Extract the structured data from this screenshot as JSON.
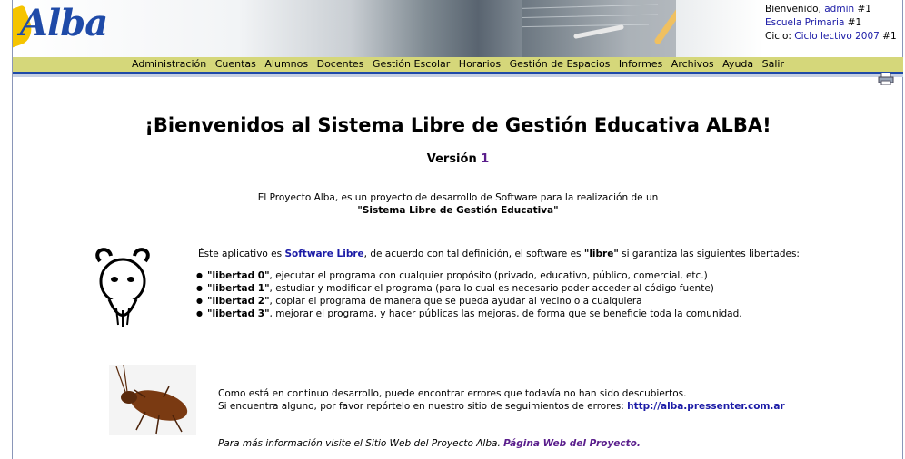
{
  "user": {
    "welcome_prefix": "Bienvenido, ",
    "username": "admin",
    "username_suffix": " #1",
    "school": "Escuela Primaria",
    "school_suffix": " #1",
    "cycle_prefix": "Ciclo: ",
    "cycle": "Ciclo lectivo 2007",
    "cycle_suffix": " #1"
  },
  "logo": {
    "text": "Alba"
  },
  "menu": [
    "Administración",
    "Cuentas",
    "Alumnos",
    "Docentes",
    "Gestión Escolar",
    "Horarios",
    "Gestión de Espacios",
    "Informes",
    "Archivos",
    "Ayuda",
    "Salir"
  ],
  "main": {
    "title": "¡Bienvenidos al Sistema Libre de Gestión Educativa ALBA!",
    "version_label": "Versión ",
    "version_number": "1",
    "intro_line1": "El Proyecto Alba, es un proyecto de desarrollo de Software para la realización de un",
    "intro_line2": "\"Sistema Libre de Gestión Educativa\"",
    "free_prefix": "Éste aplicativo es ",
    "free_link": "Software Libre",
    "free_middle": ", de acuerdo con tal definición, el software es ",
    "free_word": "\"libre\"",
    "free_suffix": " si garantiza las siguientes libertades:",
    "freedoms": [
      {
        "name": "\"libertad 0\"",
        "desc": ", ejecutar el programa con cualquier propósito (privado, educativo, público, comercial, etc.)"
      },
      {
        "name": "\"libertad 1\"",
        "desc": ", estudiar y modificar el programa (para lo cual es necesario poder acceder al código fuente)"
      },
      {
        "name": "\"libertad 2\"",
        "desc": ", copiar el programa de manera que se pueda ayudar al vecino o a cualquiera"
      },
      {
        "name": "\"libertad 3\"",
        "desc": ", mejorar el programa, y hacer públicas las mejoras, de forma que se beneficie toda la comunidad."
      }
    ],
    "bug_line1": "Como está en continuo desarrollo, puede encontrar errores que todavía no han sido descubiertos.",
    "bug_line2": "Si encuentra alguno, por favor repórtelo en nuestro sitio de seguimientos de errores: ",
    "bug_link": "http://alba.pressenter.com.ar",
    "more_prefix": "Para más información visite el Sitio Web del Proyecto Alba. ",
    "more_link": "Página Web del Proyecto."
  },
  "icons": {
    "print": "printer-icon",
    "gnu": "gnu-head-image",
    "bug": "cockroach-image"
  }
}
